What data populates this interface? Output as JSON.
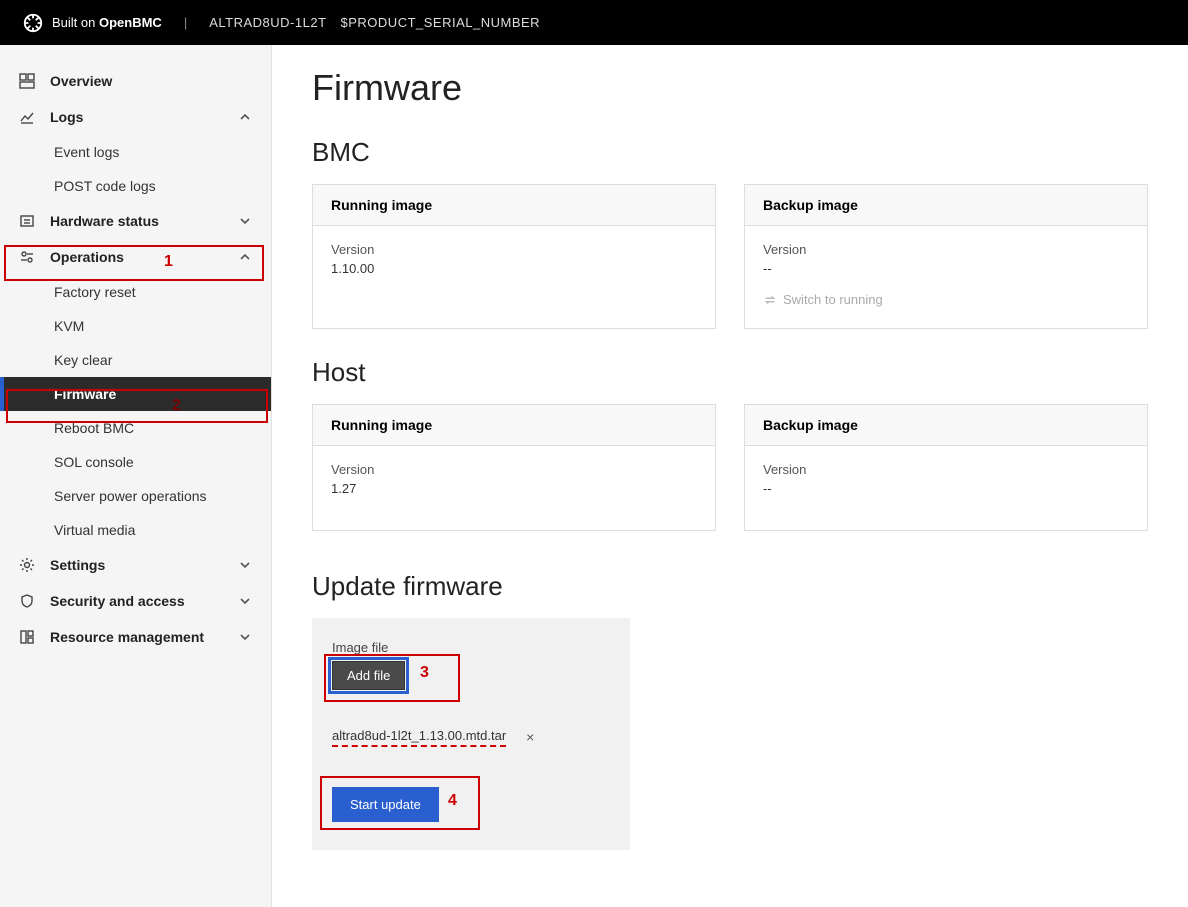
{
  "header": {
    "brand_prefix": "Built on ",
    "brand_bold": "OpenBMC",
    "model": "ALTRAD8UD-1L2T",
    "serial": "$PRODUCT_SERIAL_NUMBER"
  },
  "sidebar": {
    "overview": "Overview",
    "logs": {
      "label": "Logs",
      "items": [
        "Event logs",
        "POST code logs"
      ]
    },
    "hardware": "Hardware status",
    "operations": {
      "label": "Operations",
      "items": [
        "Factory reset",
        "KVM",
        "Key clear",
        "Firmware",
        "Reboot BMC",
        "SOL console",
        "Server power operations",
        "Virtual media"
      ]
    },
    "settings": "Settings",
    "security": "Security and access",
    "resource": "Resource management"
  },
  "page": {
    "title": "Firmware",
    "bmc": {
      "heading": "BMC",
      "running": {
        "title": "Running image",
        "version_label": "Version",
        "version": "1.10.00"
      },
      "backup": {
        "title": "Backup image",
        "version_label": "Version",
        "version": "--",
        "switch_label": "Switch to running"
      }
    },
    "host": {
      "heading": "Host",
      "running": {
        "title": "Running image",
        "version_label": "Version",
        "version": "1.27"
      },
      "backup": {
        "title": "Backup image",
        "version_label": "Version",
        "version": "--"
      }
    },
    "update": {
      "heading": "Update firmware",
      "image_file_label": "Image file",
      "add_file": "Add file",
      "file_name": "altrad8ud-1l2t_1.13.00.mtd.tar",
      "clear": "×",
      "start": "Start update"
    }
  },
  "annotations": {
    "n1": "1",
    "n2": "2",
    "n3": "3",
    "n4": "4"
  }
}
